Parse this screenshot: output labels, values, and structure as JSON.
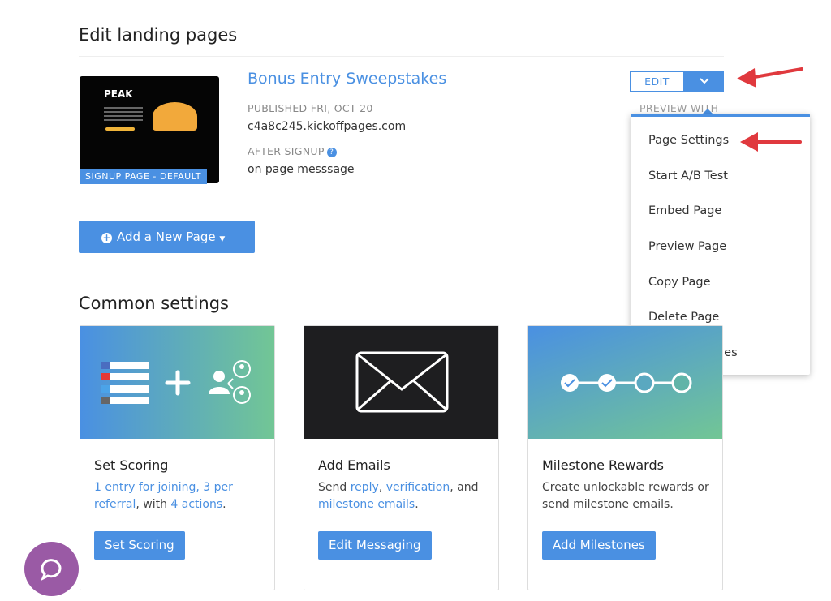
{
  "header": {
    "title": "Edit landing pages"
  },
  "landing_page": {
    "thumbnail_badge": "SIGNUP PAGE - DEFAULT",
    "thumbnail_logo": "PEAK",
    "title": "Bonus Entry Sweepstakes",
    "published": "PUBLISHED FRI, OCT 20",
    "domain": "c4a8c245.kickoffpages.com",
    "after_signup_label": "AFTER SIGNUP",
    "after_signup_value": "on page messsage",
    "edit_label": "EDIT",
    "preview_with": "PREVIEW WITH"
  },
  "dropdown": {
    "items": [
      "Page Settings",
      "Start A/B Test",
      "Embed Page",
      "Preview Page",
      "Copy Page",
      "Delete Page",
      "Tracking Codes"
    ]
  },
  "add_page": {
    "label": "Add a New Page"
  },
  "common": {
    "title": "Common settings",
    "cards": [
      {
        "title": "Set Scoring",
        "desc_parts": [
          "1 entry for joining, 3 per referral",
          ", with ",
          "4 actions",
          "."
        ],
        "button": "Set Scoring"
      },
      {
        "title": "Add Emails",
        "desc_parts": [
          "Send ",
          "reply",
          ", ",
          "verification",
          ", and ",
          "milestone emails",
          "."
        ],
        "button": "Edit Messaging"
      },
      {
        "title": "Milestone Rewards",
        "desc": "Create unlockable rewards or send milestone emails.",
        "button": "Add Milestones"
      }
    ]
  },
  "colors": {
    "accent": "#4a90e2",
    "annotation_arrow": "#e0393e",
    "chat": "#9a5aa5"
  }
}
